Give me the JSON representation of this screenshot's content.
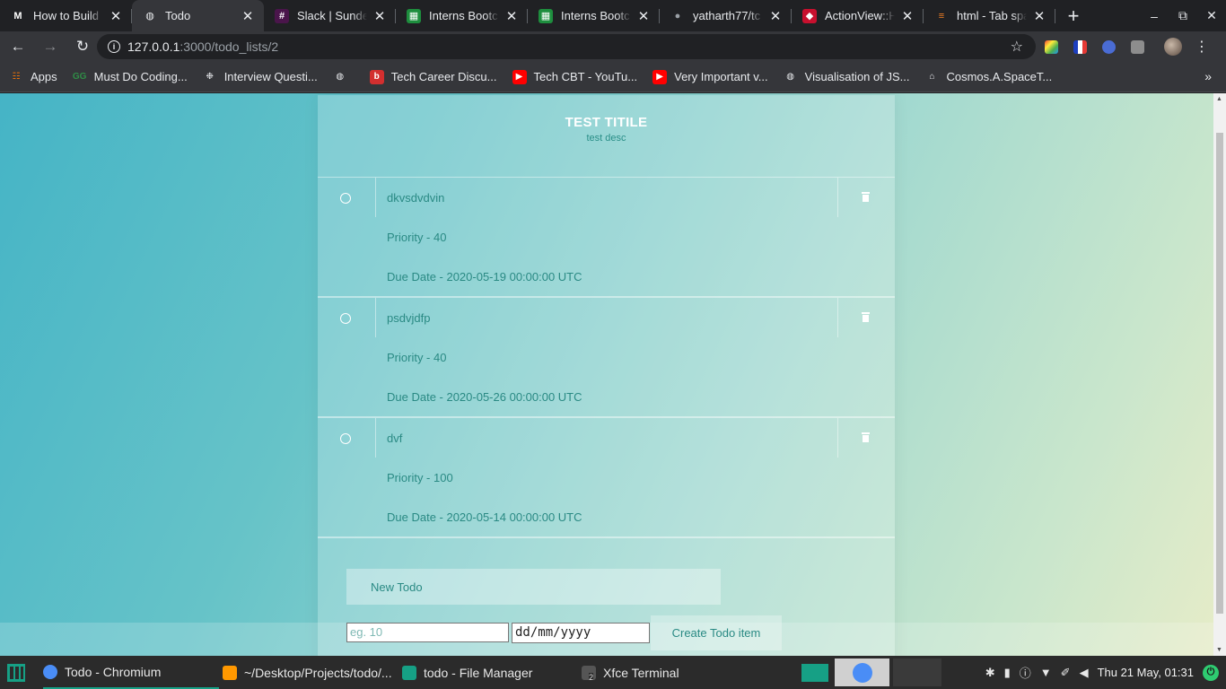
{
  "browser": {
    "tabs": [
      {
        "title": "How to Build",
        "favicon_text": "M",
        "favicon_color": "#ffffff",
        "favicon_bg": "transparent"
      },
      {
        "title": "Todo",
        "favicon_text": "◍",
        "favicon_color": "#e8eaed",
        "favicon_bg": "transparent"
      },
      {
        "title": "Slack | Sunde",
        "favicon_text": "#",
        "favicon_color": "#ffffff",
        "favicon_bg": "#4a154b"
      },
      {
        "title": "Interns Bootc",
        "favicon_text": "▦",
        "favicon_color": "#ffffff",
        "favicon_bg": "#1e8e3e"
      },
      {
        "title": "Interns Bootc",
        "favicon_text": "▦",
        "favicon_color": "#ffffff",
        "favicon_bg": "#1e8e3e"
      },
      {
        "title": "yatharth77/tc",
        "favicon_text": "●",
        "favicon_color": "#9aa0a6",
        "favicon_bg": "transparent"
      },
      {
        "title": "ActionView::H",
        "favicon_text": "◆",
        "favicon_color": "#ffffff",
        "favicon_bg": "#c8102e"
      },
      {
        "title": "html - Tab spa",
        "favicon_text": "≡",
        "favicon_color": "#f48024",
        "favicon_bg": "transparent"
      }
    ],
    "active_tab_index": 1,
    "new_tab_symbol": "+",
    "url_host": "127.0.0.1",
    "url_path": ":3000/todo_lists/2",
    "bookmarks": [
      {
        "label": "Apps",
        "icon": "apps-grid-icon",
        "color": "#e8710a"
      },
      {
        "label": "Must Do Coding...",
        "icon": "geeksforgeeks-icon",
        "color": "#2f8d46"
      },
      {
        "label": "Interview Questi...",
        "icon": "lamp-icon",
        "color": "#e8eaed"
      },
      {
        "label": "",
        "icon": "globe-icon",
        "color": "#e8eaed"
      },
      {
        "label": "Tech Career Discu...",
        "icon": "b-icon",
        "color": "#d32f2f"
      },
      {
        "label": "Tech CBT - YouTu...",
        "icon": "youtube-icon",
        "color": "#ff0000"
      },
      {
        "label": "Very Important v...",
        "icon": "youtube-icon",
        "color": "#ff0000"
      },
      {
        "label": "Visualisation of JS...",
        "icon": "globe-icon",
        "color": "#e8eaed"
      },
      {
        "label": "Cosmos.A.SpaceT...",
        "icon": "library-icon",
        "color": "#e8eaed"
      }
    ]
  },
  "todo_list": {
    "title": "TEST TITILE",
    "description": "test desc",
    "items": [
      {
        "name": "dkvsdvdvin",
        "priority": "Priority - 40",
        "due": "Due Date - 2020-05-19 00:00:00 UTC"
      },
      {
        "name": "psdvjdfp",
        "priority": "Priority - 40",
        "due": "Due Date - 2020-05-26 00:00:00 UTC"
      },
      {
        "name": "dvf",
        "priority": "Priority - 100",
        "due": "Due Date - 2020-05-14 00:00:00 UTC"
      }
    ],
    "form": {
      "new_todo_placeholder": "New Todo",
      "priority_placeholder": "eg. 10",
      "date_placeholder": "dd/mm/yyyy",
      "submit_label": "Create Todo item"
    }
  },
  "taskbar": {
    "tasks": [
      {
        "label": "Todo - Chromium",
        "icon_color": "#4a8df6",
        "active": true
      },
      {
        "label": "~/Desktop/Projects/todo/...",
        "icon_color": "#ff9800",
        "active": false
      },
      {
        "label": "todo - File Manager",
        "icon_color": "#16a085",
        "active": false
      },
      {
        "label": "Xfce Terminal",
        "icon_color": "#555555",
        "active": false
      }
    ],
    "terminal_badge": "2",
    "clock": "Thu 21 May, 01:31"
  },
  "colors": {
    "accent_text": "#2a8a84",
    "page_gradient_start": "#45b4c6",
    "page_gradient_end": "#e6ecc8",
    "taskbar_accent": "#16a085"
  }
}
